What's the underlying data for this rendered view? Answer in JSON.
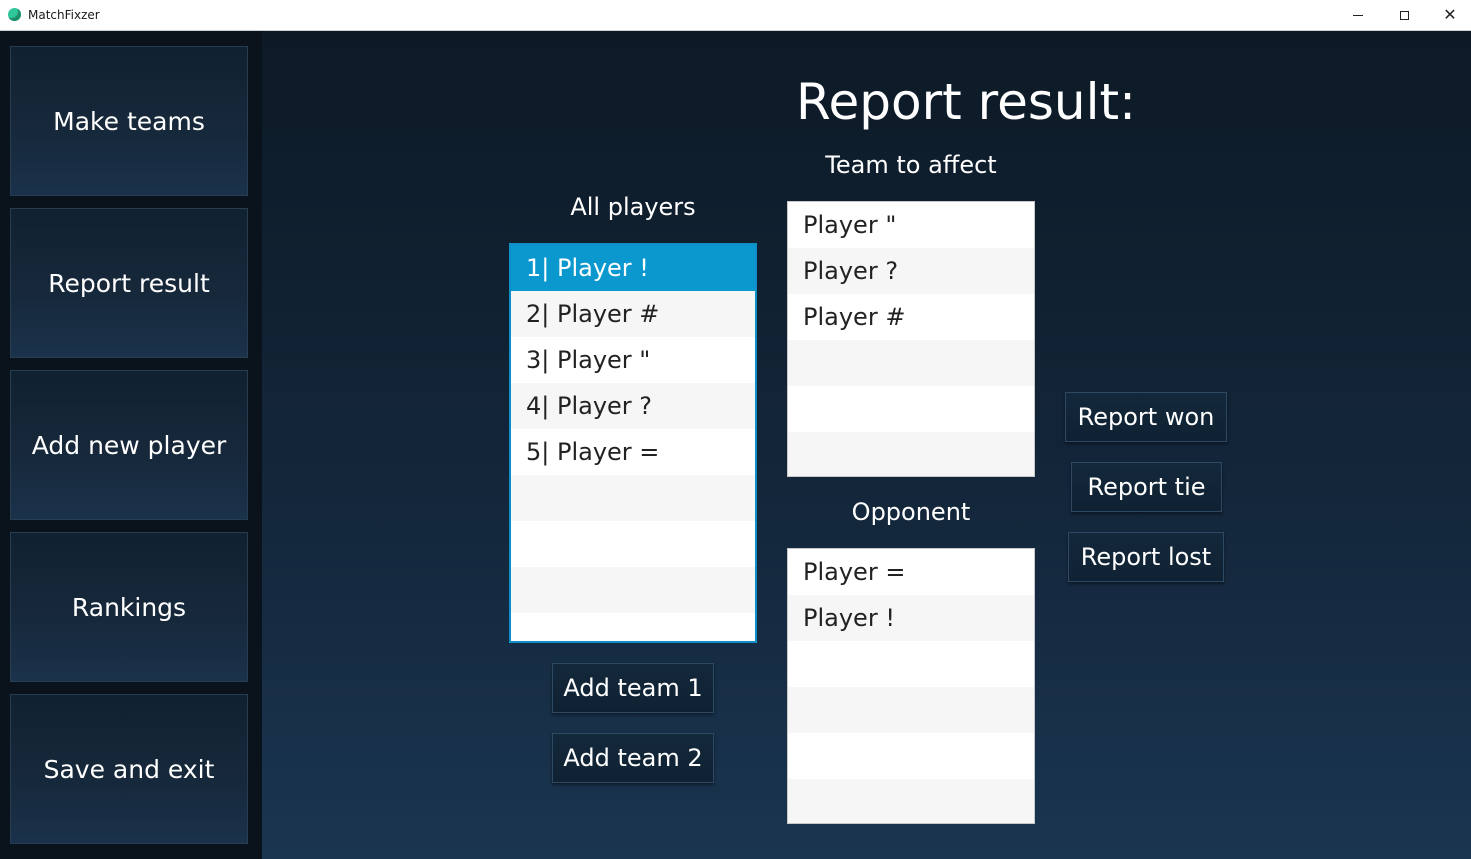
{
  "window": {
    "title": "MatchFixzer",
    "minimize_label": "—",
    "maximize_label": "□",
    "close_label": "✕"
  },
  "sidebar": {
    "items": [
      {
        "label": "Make teams"
      },
      {
        "label": "Report result"
      },
      {
        "label": "Add new player"
      },
      {
        "label": "Rankings"
      },
      {
        "label": "Save and exit"
      }
    ]
  },
  "main": {
    "title": "Report result:",
    "all_players": {
      "label": "All players",
      "items": [
        "1| Player !",
        "2| Player #",
        "3| Player \"",
        "4| Player ?",
        "5| Player ="
      ],
      "selected_index": 0
    },
    "team_to_affect": {
      "label": "Team to affect",
      "items": [
        "Player \"",
        "Player ?",
        "Player #"
      ]
    },
    "opponent": {
      "label": "Opponent",
      "items": [
        "Player =",
        "Player !"
      ]
    },
    "buttons": {
      "add_team_1": "Add team 1",
      "add_team_2": "Add team 2",
      "report_won": "Report won",
      "report_tie": "Report tie",
      "report_lost": "Report lost"
    }
  },
  "colors": {
    "selection": "#0a98cf",
    "app_icon": "#2fc79a",
    "sidebar_bg": "#0a131b",
    "main_bg": "#13263a"
  }
}
